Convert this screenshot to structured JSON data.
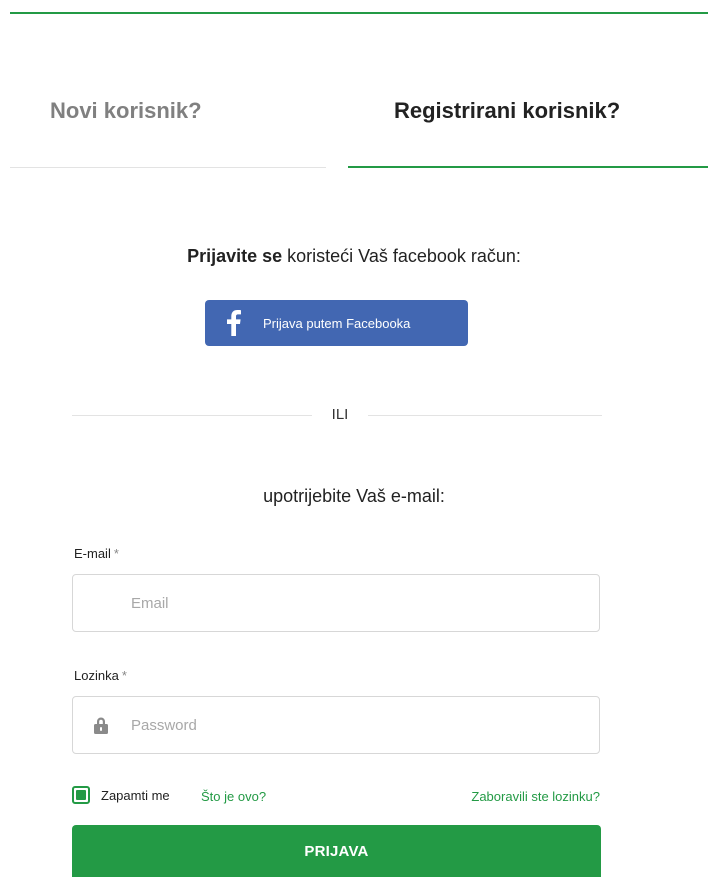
{
  "theme": {
    "accent": "#239a45",
    "facebook": "#4267b2",
    "muted_text": "#808080"
  },
  "tabs": [
    {
      "label": "Novi korisnik?",
      "active": false
    },
    {
      "label": "Registrirani korisnik?",
      "active": true
    }
  ],
  "facebook": {
    "prompt_bold": "Prijavite se",
    "prompt_rest": " koristeći Vaš facebook račun:",
    "button_label": "Prijava putem Facebooka",
    "icon": "facebook-f-icon"
  },
  "divider": {
    "text": "ILI"
  },
  "email_prompt": "upotrijebite Vaš e-mail:",
  "form": {
    "email": {
      "label": "E-mail",
      "required_mark": "*",
      "placeholder": "Email",
      "value": ""
    },
    "password": {
      "label": "Lozinka",
      "required_mark": "*",
      "placeholder": "Password",
      "value": "",
      "icon": "lock-icon"
    },
    "remember": {
      "label": "Zapamti me",
      "checked": true
    },
    "what_is_this_link": "Što je ovo?",
    "forgot_link": "Zaboravili ste lozinku?",
    "submit_label": "PRIJAVA"
  }
}
